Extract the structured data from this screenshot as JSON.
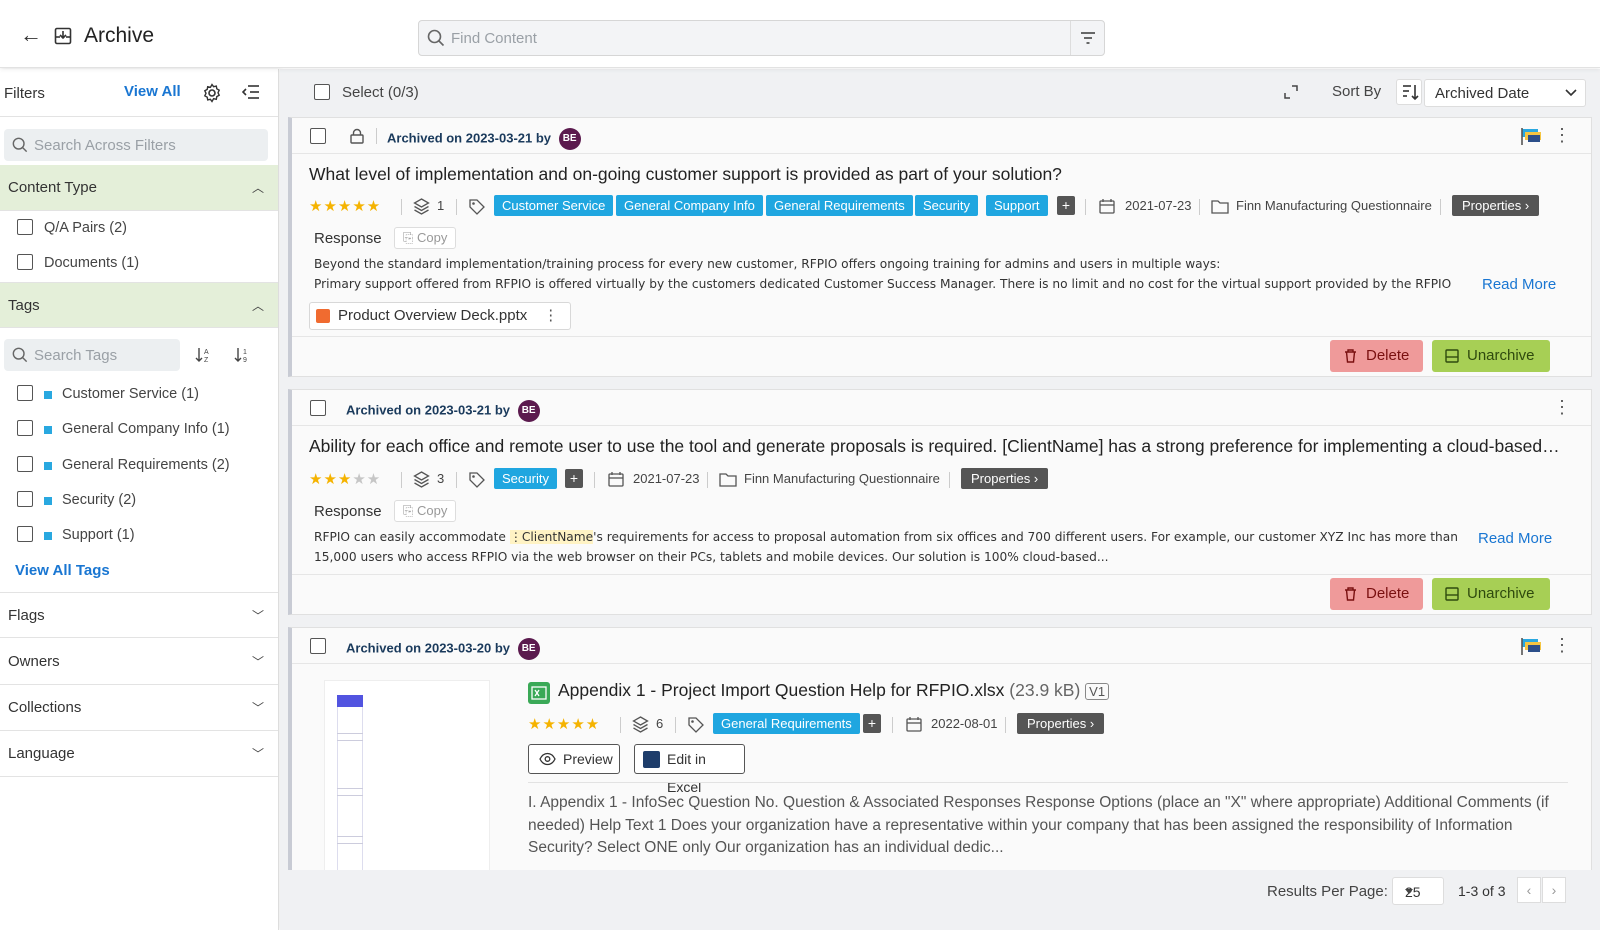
{
  "header": {
    "title": "Archive",
    "search_placeholder": "Find Content"
  },
  "sidebar": {
    "title": "Filters",
    "view_all": "View All",
    "search_placeholder": "Search Across Filters",
    "content_type": {
      "label": "Content Type",
      "items": [
        {
          "label": "Q/A Pairs (2)"
        },
        {
          "label": "Documents (1)"
        }
      ]
    },
    "tags": {
      "label": "Tags",
      "search_placeholder": "Search Tags",
      "items": [
        {
          "label": "Customer Service (1)"
        },
        {
          "label": "General Company Info (1)"
        },
        {
          "label": "General Requirements (2)"
        },
        {
          "label": "Security (2)"
        },
        {
          "label": "Support (1)"
        }
      ],
      "view_all": "View All Tags"
    },
    "collapsed_sections": [
      "Flags",
      "Owners",
      "Collections",
      "Language"
    ]
  },
  "toolbar": {
    "select_label": "Select (0/3)",
    "sort_label": "Sort By",
    "sort_value": "Archived Date"
  },
  "cards": [
    {
      "archived": "Archived on 2023-03-21 by",
      "avatar": "BE",
      "question": "What level of implementation and on-going customer support is provided as part of your solution?",
      "rating": 5,
      "stars": "★★★★★",
      "stars_off": "",
      "versions": "1",
      "tags": [
        "Customer Service",
        "General Company Info",
        "General Requirements",
        "Security",
        "Support"
      ],
      "date": "2021-07-23",
      "project": "Finn Manufacturing Questionnaire",
      "properties": "Properties",
      "response_label": "Response",
      "copy": "Copy",
      "response_line1": "Beyond the standard implementation/training process for every new customer, RFPIO offers ongoing training for admins and users in multiple ways:",
      "response_line2": "Primary support offered from RFPIO is offered virtually by the customers dedicated Customer Success Manager. There is no limit and no cost for the virtual support provided by the RFPIO",
      "read_more": "Read More",
      "attachment": "Product Overview Deck.pptx",
      "delete": "Delete",
      "unarchive": "Unarchive"
    },
    {
      "archived": "Archived on 2023-03-21 by",
      "avatar": "BE",
      "question": "Ability for each office and remote user to use the tool and generate proposals is required. [ClientName] has a strong preference for implementing a cloud-based…",
      "rating": 3,
      "stars": "★★★",
      "stars_off": "★★",
      "versions": "3",
      "tags": [
        "Security"
      ],
      "date": "2021-07-23",
      "project": "Finn Manufacturing Questionnaire",
      "properties": "Properties",
      "response_label": "Response",
      "copy": "Copy",
      "response_pre": "RFPIO can easily accommodate ",
      "response_var": "ClientName",
      "response_post": "'s requirements for access to proposal automation from six offices and 700 different users. For example, our customer XYZ Inc has more than",
      "response_line2": "15,000 users who access RFPIO via the web browser on their PCs, tablets and mobile devices. Our solution is 100% cloud-based...",
      "read_more": "Read More",
      "delete": "Delete",
      "unarchive": "Unarchive"
    },
    {
      "archived": "Archived on 2023-03-20 by",
      "avatar": "BE",
      "file_name": "Appendix 1 - Project Import Question Help for RFPIO.xlsx",
      "file_size": "(23.9 kB)",
      "version_badge": "V1",
      "rating": 5,
      "stars": "★★★★★",
      "versions": "6",
      "tags": [
        "General Requirements"
      ],
      "date": "2022-08-01",
      "properties": "Properties",
      "preview": "Preview",
      "edit_excel": "Edit in Excel",
      "excerpt": "I. Appendix 1 - InfoSec Question No. Question & Associated Responses Response Options (place an \"X\" where appropriate) Additional Comments (if needed) Help Text 1 Does your organization have a representative within your company that has been assigned the responsibility of Information Security? Select ONE only Our organization has an individual dedic..."
    }
  ],
  "pagination": {
    "label": "Results Per Page:",
    "per_page": "25",
    "range": "1-3 of 3"
  },
  "colors": {
    "tag": "#1fa6e0",
    "delete": "#ef9a9a",
    "unarchive": "#a7cf55",
    "link": "#1976d2",
    "active_section": "#e4efd9",
    "avatar": "#5b1a4e"
  }
}
